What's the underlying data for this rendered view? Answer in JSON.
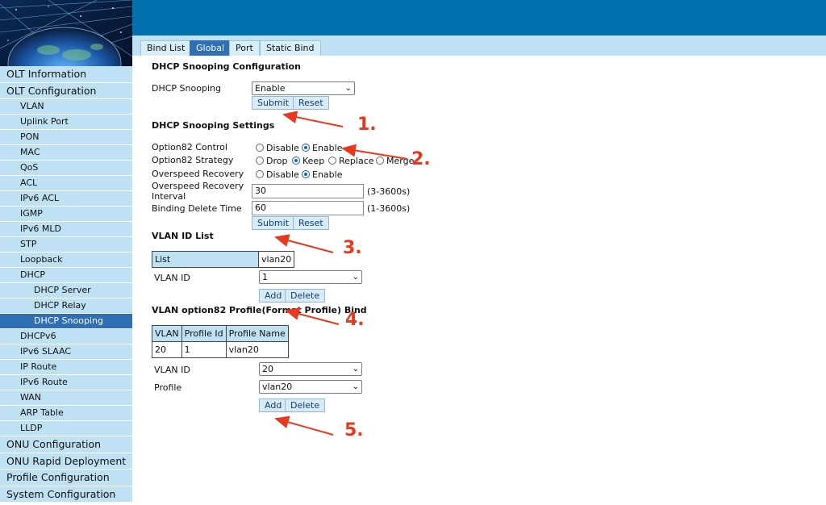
{
  "sidebar": {
    "items": [
      {
        "label": "OLT Information",
        "level": 0
      },
      {
        "label": "OLT Configuration",
        "level": 0
      },
      {
        "label": "VLAN",
        "level": 1
      },
      {
        "label": "Uplink Port",
        "level": 1
      },
      {
        "label": "PON",
        "level": 1
      },
      {
        "label": "MAC",
        "level": 1
      },
      {
        "label": "QoS",
        "level": 1
      },
      {
        "label": "ACL",
        "level": 1
      },
      {
        "label": "IPv6 ACL",
        "level": 1
      },
      {
        "label": "IGMP",
        "level": 1
      },
      {
        "label": "IPv6 MLD",
        "level": 1
      },
      {
        "label": "STP",
        "level": 1
      },
      {
        "label": "Loopback",
        "level": 1
      },
      {
        "label": "DHCP",
        "level": 1
      },
      {
        "label": "DHCP Server",
        "level": 2
      },
      {
        "label": "DHCP Relay",
        "level": 2
      },
      {
        "label": "DHCP Snooping",
        "level": 2,
        "active": true
      },
      {
        "label": "DHCPv6",
        "level": 1
      },
      {
        "label": "IPv6 SLAAC",
        "level": 1
      },
      {
        "label": "IP Route",
        "level": 1
      },
      {
        "label": "IPv6 Route",
        "level": 1
      },
      {
        "label": "WAN",
        "level": 1
      },
      {
        "label": "ARP Table",
        "level": 1
      },
      {
        "label": "LLDP",
        "level": 1
      },
      {
        "label": "ONU Configuration",
        "level": 0
      },
      {
        "label": "ONU Rapid Deployment",
        "level": 0
      },
      {
        "label": "Profile Configuration",
        "level": 0
      },
      {
        "label": "System Configuration",
        "level": 0
      }
    ]
  },
  "tabs": [
    {
      "label": "Bind List"
    },
    {
      "label": "Global",
      "active": true
    },
    {
      "label": "Port"
    },
    {
      "label": "Static Bind"
    }
  ],
  "config": {
    "title": "DHCP Snooping Configuration",
    "snooping_label": "DHCP Snooping",
    "snooping_value": "Enable",
    "submit": "Submit",
    "reset": "Reset"
  },
  "settings": {
    "title": "DHCP Snooping Settings",
    "option82_control_label": "Option82 Control",
    "option82_control_options": [
      "Disable",
      "Enable"
    ],
    "option82_strategy_label": "Option82 Strategy",
    "option82_strategy_options": [
      "Drop",
      "Keep",
      "Replace",
      "Merge"
    ],
    "overspeed_recovery_label": "Overspeed Recovery",
    "overspeed_recovery_options": [
      "Disable",
      "Enable"
    ],
    "interval_label_1": "Overspeed Recovery",
    "interval_label_2": "Interval",
    "interval_value": "30",
    "interval_range": "(3-3600s)",
    "binding_delete_label": "Binding Delete Time",
    "binding_delete_value": "60",
    "binding_delete_range": "(1-3600s)",
    "submit": "Submit",
    "reset": "Reset"
  },
  "vlan_list": {
    "title": "VLAN ID List",
    "list_header": "List",
    "list_value": "vlan20",
    "vlan_id_label": "VLAN ID",
    "vlan_id_value": "1",
    "add": "Add",
    "delete": "Delete"
  },
  "profile_bind": {
    "title": "VLAN option82 Profile(Format Profile) Bind",
    "columns": [
      "VLAN",
      "Profile Id",
      "Profile Name"
    ],
    "rows": [
      [
        "20",
        "1",
        "vlan20"
      ]
    ],
    "vlan_id_label": "VLAN ID",
    "vlan_id_value": "20",
    "profile_label": "Profile",
    "profile_value": "vlan20",
    "add": "Add",
    "delete": "Delete"
  },
  "annotations": [
    "1.",
    "2.",
    "3.",
    "4.",
    "5."
  ],
  "colors": {
    "banner": "#0170ac",
    "menu_bg": "#bfe1f4",
    "menu_active": "#2f6fb4",
    "annotation_red": "#e8391e"
  }
}
